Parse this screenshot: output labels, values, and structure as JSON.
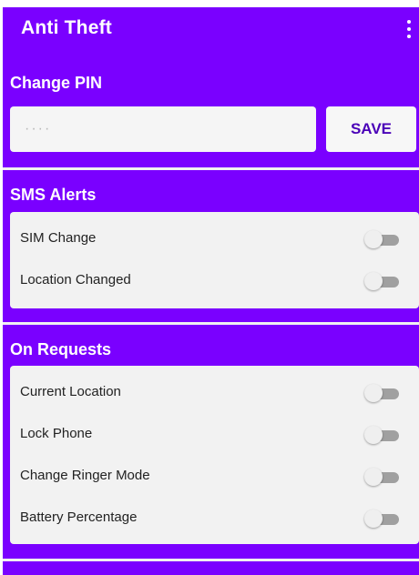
{
  "appbar": {
    "title": "Anti Theft",
    "menu_icon": "more-vert-icon"
  },
  "change_pin": {
    "title": "Change PIN",
    "input_placeholder": "····",
    "save_label": "SAVE"
  },
  "sms_alerts": {
    "title": "SMS Alerts",
    "items": [
      {
        "label": "SIM Change",
        "enabled": false
      },
      {
        "label": "Location Changed",
        "enabled": false
      }
    ]
  },
  "on_requests": {
    "title": "On Requests",
    "items": [
      {
        "label": "Current Location",
        "enabled": false
      },
      {
        "label": "Lock Phone",
        "enabled": false
      },
      {
        "label": "Change Ringer Mode",
        "enabled": false
      },
      {
        "label": "Battery Percentage",
        "enabled": false
      }
    ]
  },
  "colors": {
    "primary": "#7a00ff",
    "accent_text": "#4a00b8",
    "card": "#f2f2f2",
    "switch_track_off": "#a0a0a0",
    "switch_thumb_off": "#efefef"
  }
}
